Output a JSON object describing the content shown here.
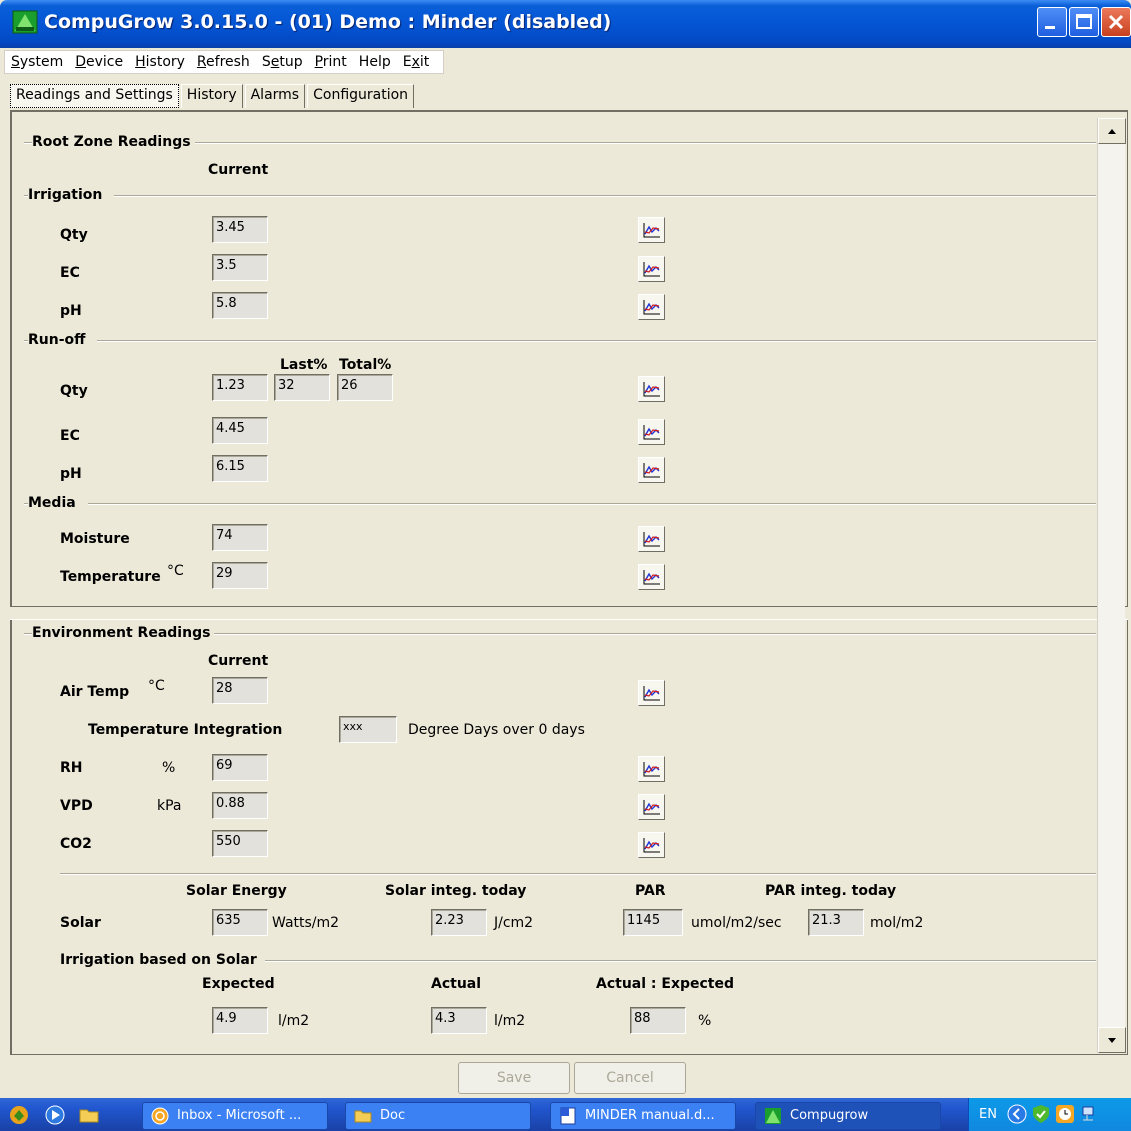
{
  "window": {
    "title": "CompuGrow 3.0.15.0 - (01) Demo : Minder (disabled)"
  },
  "menu": [
    {
      "pre": "",
      "ul": "S",
      "post": "ystem"
    },
    {
      "pre": "",
      "ul": "D",
      "post": "evice"
    },
    {
      "pre": "",
      "ul": "H",
      "post": "istory"
    },
    {
      "pre": "",
      "ul": "R",
      "post": "efresh"
    },
    {
      "pre": "S",
      "ul": "e",
      "post": "tup"
    },
    {
      "pre": "",
      "ul": "P",
      "post": "rint"
    },
    {
      "pre": "",
      "ul": "",
      "post": "Help"
    },
    {
      "pre": "E",
      "ul": "x",
      "post": "it"
    }
  ],
  "tabs": [
    "Readings and Settings",
    "History",
    "Alarms",
    "Configuration"
  ],
  "root_zone": {
    "title": "Root Zone Readings",
    "current_header": "Current",
    "irrigation": {
      "title": "Irrigation",
      "qty_label": "Qty",
      "qty": "3.45",
      "ec_label": "EC",
      "ec": "3.5",
      "ph_label": "pH",
      "ph": "5.8"
    },
    "runoff": {
      "title": "Run-off",
      "last_header": "Last%",
      "total_header": "Total%",
      "qty_label": "Qty",
      "qty": "1.23",
      "last_pct": "32",
      "total_pct": "26",
      "ec_label": "EC",
      "ec": "4.45",
      "ph_label": "pH",
      "ph": "6.15"
    },
    "media": {
      "title": "Media",
      "moisture_label": "Moisture",
      "moisture": "74",
      "temp_label": "Temperature",
      "temp_unit": "°C",
      "temp": "29"
    }
  },
  "environment": {
    "title": "Environment Readings",
    "current_header": "Current",
    "air_temp_label": "Air Temp",
    "air_temp_unit": "°C",
    "air_temp": "28",
    "temp_integration_label": "Temperature Integration",
    "temp_integration": "xxx",
    "temp_integration_desc": "Degree Days over 0 days",
    "rh_label": "RH",
    "rh_unit": "%",
    "rh": "69",
    "vpd_label": "VPD",
    "vpd_unit": "kPa",
    "vpd": "0.88",
    "co2_label": "CO2",
    "co2": "550"
  },
  "solar": {
    "label": "Solar",
    "energy_header": "Solar Energy",
    "energy": "635",
    "energy_unit": "Watts/m2",
    "integ_header": "Solar integ. today",
    "integ": "2.23",
    "integ_unit": "J/cm2",
    "par_header": "PAR",
    "par": "1145",
    "par_unit": "umol/m2/sec",
    "par_integ_header": "PAR integ. today",
    "par_integ": "21.3",
    "par_integ_unit": "mol/m2"
  },
  "irrigation_solar": {
    "title": "Irrigation based on Solar",
    "expected_header": "Expected",
    "expected": "4.9",
    "expected_unit": "l/m2",
    "actual_header": "Actual",
    "actual": "4.3",
    "actual_unit": "l/m2",
    "ratio_header": "Actual : Expected",
    "ratio": "88",
    "ratio_unit": "%"
  },
  "buttons": {
    "save": "Save",
    "cancel": "Cancel"
  },
  "taskbar": {
    "items": [
      "Inbox - Microsoft ...",
      "Doc",
      "MINDER manual.d...",
      "Compugrow"
    ],
    "lang": "EN"
  },
  "colors": {
    "titlebar": "#0455d4",
    "panel": "#ece9d8",
    "taskbar": "#2157d0"
  }
}
